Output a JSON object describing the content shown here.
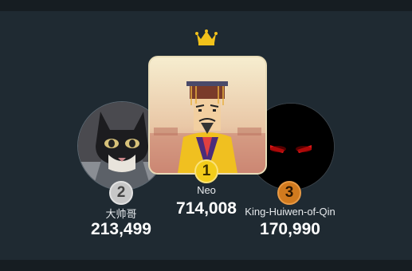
{
  "leaderboard": {
    "crown_icon": "crown-icon",
    "colors": {
      "background": "#1f2a32",
      "gold": "#f2cc1a",
      "silver": "#c7c7c7",
      "bronze": "#d17a1e"
    },
    "entries": [
      {
        "rank": "1",
        "name": "Neo",
        "score": "714,008",
        "avatar": "emperor-avatar"
      },
      {
        "rank": "2",
        "name": "大帅哥",
        "score": "213,499",
        "avatar": "batman-cat-avatar"
      },
      {
        "rank": "3",
        "name": "King-Huiwen-of-Qin",
        "score": "170,990",
        "avatar": "dark-eyes-avatar"
      }
    ]
  }
}
